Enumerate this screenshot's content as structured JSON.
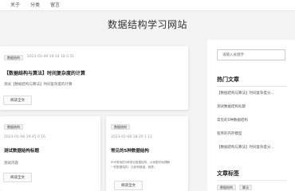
{
  "nav": {
    "items": [
      "关于",
      "分类",
      "留言"
    ]
  },
  "site": {
    "title": "数据结构学习网站"
  },
  "posts": [
    {
      "tag": "数据结构",
      "date": "2023-01-09 19:34 18 0.51",
      "title": "【数据结构与算法】时间复杂度的计算",
      "excerpt": "测试【数据结构与算法】时间复杂度的计算",
      "read_label": "阅读全文"
    },
    {
      "tag": "数据结构",
      "date": "2023-01-08 19:45 0 16",
      "title": "测试数据结构标题",
      "excerpt": "测试内容",
      "read_label": "阅读全文"
    },
    {
      "tag": "数据结构",
      "date": "2023-01-08 18:20 1 11",
      "title": "常见的5种数据结构",
      "excerpt": "PHP常用的5种常见数据结构，从而更好地理解一些数据结构，比如有数组、链表...",
      "read_label": "阅读全文"
    }
  ],
  "sidebar": {
    "search_placeholder": "请输入关键字",
    "hot_heading": "热门文章",
    "hot_items": [
      "【数据结构与算法】时间复杂度分...",
      "测试数据结构标题",
      "常见的5种数据结构",
      "程序的内存模型",
      "【数据结构与算法】时间复杂度分..."
    ],
    "tags_heading": "文章标签",
    "tags": [
      "数据结构",
      "算法"
    ]
  },
  "colors": {
    "background": "#f3f3f3",
    "card": "#ffffff",
    "accent": "#222222"
  }
}
